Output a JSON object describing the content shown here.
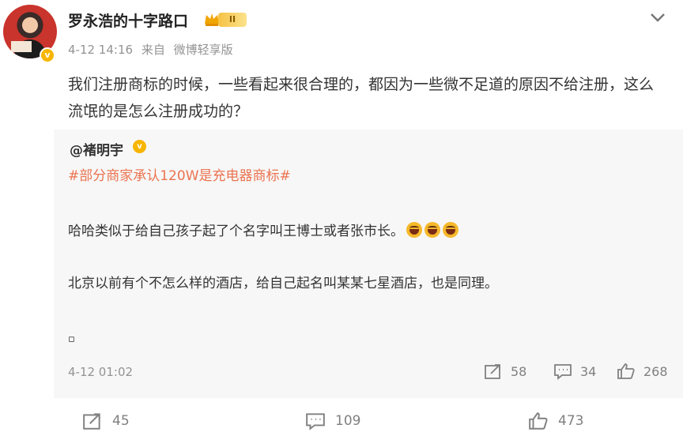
{
  "author": {
    "name": "罗永浩的十字路口",
    "level_badge": "II",
    "verify_mark": "v"
  },
  "meta": {
    "time": "4-12 14:16",
    "source_prefix": "来自",
    "source": "微博轻享版"
  },
  "post": {
    "text": "我们注册商标的时候，一些看起来很合理的，都因为一些微不足道的原因不给注册，这么流氓的是怎么注册成功的？"
  },
  "repost": {
    "user": "@褚明宇",
    "topic": "#部分商家承认120W是充电器商标#",
    "line1": "哈哈类似于给自己孩子起了个名字叫王博士或者张市长。",
    "line2": "北京以前有个不怎么样的酒店，给自己起名叫某某七星酒店，也是同理。",
    "square": "▫",
    "date": "4-12 01:02",
    "reposts": "58",
    "comments": "34",
    "likes": "268"
  },
  "actions": {
    "reposts": "45",
    "comments": "109",
    "likes": "473"
  },
  "colors": {
    "topic": "#eb7350",
    "meta": "#939393",
    "badge": "#f7b500"
  }
}
